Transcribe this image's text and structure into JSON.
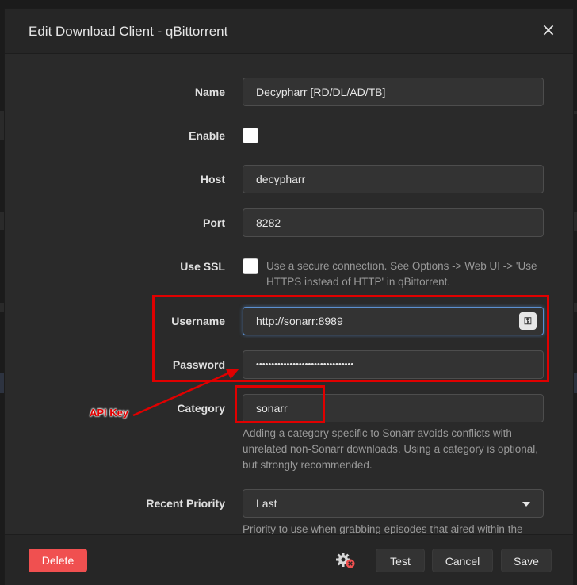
{
  "dialog": {
    "title": "Edit Download Client - qBittorrent",
    "close": "×"
  },
  "fields": {
    "name": {
      "label": "Name",
      "value": "Decypharr [RD/DL/AD/TB]"
    },
    "enable": {
      "label": "Enable",
      "checked": false
    },
    "host": {
      "label": "Host",
      "value": "decypharr"
    },
    "port": {
      "label": "Port",
      "value": "8282"
    },
    "use_ssl": {
      "label": "Use SSL",
      "checked": false,
      "help": "Use a secure connection. See Options -> Web UI -> 'Use HTTPS instead of HTTP' in qBittorrent."
    },
    "username": {
      "label": "Username",
      "value": "http://sonarr:8989"
    },
    "password": {
      "label": "Password",
      "value": "••••••••••••••••••••••••••••••••"
    },
    "category": {
      "label": "Category",
      "value": "sonarr",
      "help": "Adding a category specific to Sonarr avoids conflicts with unrelated non-Sonarr downloads. Using a category is optional, but strongly recommended."
    },
    "recent_priority": {
      "label": "Recent Priority",
      "value": "Last",
      "help": "Priority to use when grabbing episodes that aired within the"
    }
  },
  "footer": {
    "delete": "Delete",
    "test": "Test",
    "cancel": "Cancel",
    "save": "Save"
  },
  "annotation": {
    "label": "API Key",
    "color": "#e00000"
  },
  "colors": {
    "delete_button": "#f05050",
    "focus_border": "#5b8fcf"
  }
}
